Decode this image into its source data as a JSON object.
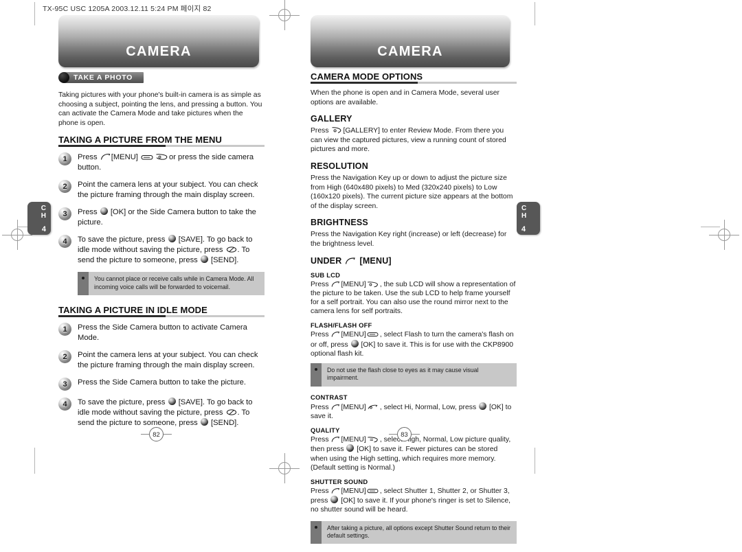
{
  "scan": {
    "header_line": "TX-95C USC 1205A  2003.12.11 5:24 PM  페이지 82"
  },
  "banner": {
    "left_title": "CAMERA",
    "right_title": "CAMERA"
  },
  "chapter_tab": {
    "line1": "C",
    "line2": "H",
    "number": "4"
  },
  "folio": {
    "left_page": "82",
    "right_page": "83"
  },
  "left_page": {
    "section_pill": "TAKE A PHOTO",
    "intro": "Taking pictures with your phone's built-in camera is as simple as choosing a subject, pointing the lens, and pressing a button. You can activate the Camera Mode and take pictures when the phone is open.",
    "heading_menu": "TAKING A PICTURE FROM THE MENU",
    "steps_menu": [
      {
        "num": "1",
        "parts": [
          "Press ",
          "[MENU] ",
          "or press the side camera button."
        ]
      },
      {
        "num": "2",
        "text": "Point the camera lens at your subject. You can check the picture framing through the main display screen."
      },
      {
        "num": "3",
        "parts": [
          "Press ",
          "[OK] or the Side Camera button to take the picture."
        ]
      },
      {
        "num": "4",
        "parts": [
          "To save the picture, press ",
          "[SAVE].  To go back to idle mode without saving the picture, press ",
          ".  To send the picture to someone, press ",
          "[SEND]."
        ]
      }
    ],
    "note_menu": "You cannot place or receive calls while in Camera Mode. All incoming voice calls will be forwarded to voicemail.",
    "heading_idle": "TAKING A PICTURE IN IDLE MODE",
    "steps_idle": [
      {
        "num": "1",
        "text": "Press the Side Camera button to activate Camera Mode."
      },
      {
        "num": "2",
        "text": "Point the camera lens at your subject. You can check the picture framing through the main display screen."
      },
      {
        "num": "3",
        "text": "Press the Side Camera button to take the picture."
      },
      {
        "num": "4",
        "parts": [
          "To save the picture, press ",
          "[SAVE].  To go back to idle mode without saving the picture, press ",
          ".  To send the picture to someone, press ",
          "[SEND]."
        ]
      }
    ]
  },
  "right_page": {
    "heading_options": "CAMERA MODE OPTIONS",
    "options_intro": "When the phone is open and in Camera Mode, several user options are available.",
    "gallery": {
      "title": "GALLERY",
      "body_pre": "Press ",
      "body_post": "[GALLERY] to enter Review Mode. From there you can view the captured pictures, view a running count of stored pictures and more."
    },
    "resolution": {
      "title": "RESOLUTION",
      "body": "Press the Navigation Key up or down to adjust the picture size from High (640x480 pixels) to Med (320x240 pixels) to Low (160x120 pixels). The current picture size appears at the bottom of the display screen."
    },
    "brightness": {
      "title": "BRIGHTNESS",
      "body": "Press the Navigation Key right (increase) or left (decrease) for the brightness level."
    },
    "under_menu": {
      "title_pre": "UNDER",
      "title_post": "[MENU]"
    },
    "sub_lcd": {
      "title": "SUB LCD",
      "body_pre": "Press ",
      "body_mid": "[MENU]",
      "body_post": ", the sub LCD will show a representation of the picture to be taken.  Use the sub LCD to help frame yourself for a self portrait. You can also use the round mirror next to the camera lens for self portraits."
    },
    "flash": {
      "title": "FLASH/FLASH OFF",
      "body_pre": "Press ",
      "body_mid": "[MENU]",
      "body_mid2": ", select Flash to turn the camera's flash on or off, press ",
      "body_post": "[OK] to save it. This is for use with the CKP8900 optional flash kit."
    },
    "flash_note": "Do not use the flash close to eyes as it may cause visual impairment.",
    "contrast": {
      "title": "CONTRAST",
      "body_pre": "Press ",
      "body_mid": "[MENU]",
      "body_mid2": ", select Hi, Normal, Low, press ",
      "body_post": "[OK] to save it."
    },
    "quality": {
      "title": "QUALITY",
      "body_pre": "Press ",
      "body_mid": "[MENU]",
      "body_mid2": ", select High, Normal, Low picture quality, then press ",
      "body_post": "[OK] to save it. Fewer pictures can be stored when using the High setting, which requires more memory. (Default setting is Normal.)"
    },
    "shutter": {
      "title": "SHUTTER SOUND",
      "body_pre": "Press ",
      "body_mid": "[MENU]",
      "body_mid2": ", select Shutter 1, Shutter 2, or Shutter 3, press ",
      "body_post": "[OK] to save it. If your phone's ringer is set to Silence, no shutter sound will be heard."
    },
    "shutter_note": "After taking a picture, all options except Shutter Sound return to their default settings."
  },
  "colors": {
    "note_bg": "#c8c8c8",
    "note_bar": "#787878",
    "tab_bg": "#575757",
    "rule_dark": "#2b2b2b",
    "rule_light": "#c9c9c9"
  }
}
